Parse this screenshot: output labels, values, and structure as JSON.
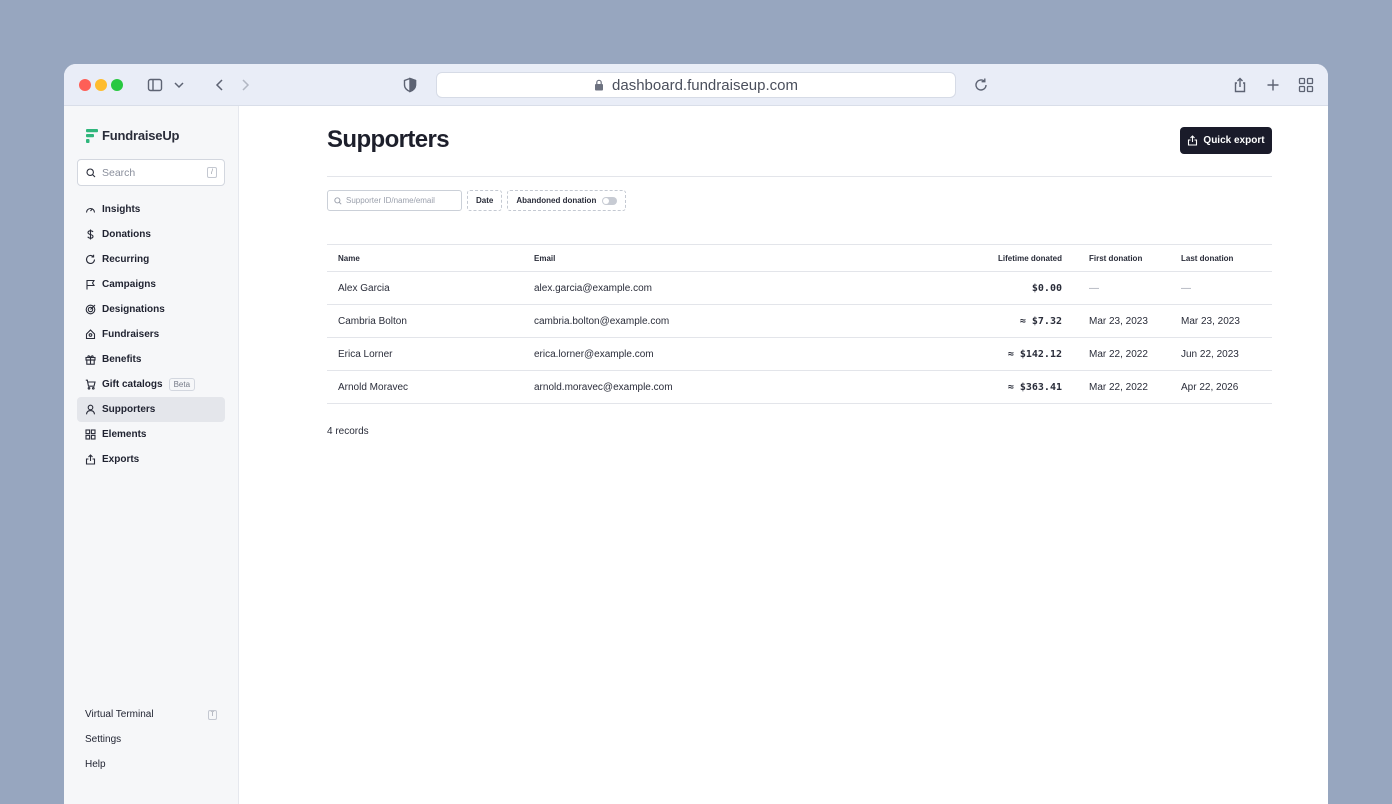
{
  "browser": {
    "url": "dashboard.fundraiseup.com"
  },
  "sidebar": {
    "brand": "FundraiseUp",
    "search_placeholder": "Search",
    "search_shortcut": "/",
    "items": [
      {
        "label": "Insights",
        "icon": "insights-icon"
      },
      {
        "label": "Donations",
        "icon": "dollar-icon"
      },
      {
        "label": "Recurring",
        "icon": "refresh-icon"
      },
      {
        "label": "Campaigns",
        "icon": "flag-icon"
      },
      {
        "label": "Designations",
        "icon": "target-icon"
      },
      {
        "label": "Fundraisers",
        "icon": "fundraiser-icon"
      },
      {
        "label": "Benefits",
        "icon": "gift-icon"
      },
      {
        "label": "Gift catalogs",
        "icon": "cart-icon",
        "badge": "Beta"
      },
      {
        "label": "Supporters",
        "icon": "person-icon",
        "active": true
      },
      {
        "label": "Elements",
        "icon": "grid-icon"
      },
      {
        "label": "Exports",
        "icon": "upload-icon"
      }
    ],
    "bottom": {
      "virtual_terminal": "Virtual Terminal",
      "virtual_terminal_shortcut": "T",
      "settings": "Settings",
      "help": "Help"
    }
  },
  "main": {
    "title": "Supporters",
    "export_label": "Quick export",
    "filters": {
      "search_placeholder": "Supporter ID/name/email",
      "date": "Date",
      "abandoned": "Abandoned donation"
    },
    "table": {
      "headers": {
        "name": "Name",
        "email": "Email",
        "lifetime": "Lifetime donated",
        "first": "First donation",
        "last": "Last donation"
      },
      "rows": [
        {
          "name": "Alex Garcia",
          "email": "alex.garcia@example.com",
          "lifetime": "$0.00",
          "first": "—",
          "last": "—"
        },
        {
          "name": "Cambria Bolton",
          "email": "cambria.bolton@example.com",
          "lifetime": "≈ $7.32",
          "first": "Mar 23, 2023",
          "last": "Mar 23, 2023"
        },
        {
          "name": "Erica Lorner",
          "email": "erica.lorner@example.com",
          "lifetime": "≈ $142.12",
          "first": "Mar 22, 2022",
          "last": "Jun 22, 2023"
        },
        {
          "name": "Arnold Moravec",
          "email": "arnold.moravec@example.com",
          "lifetime": "≈ $363.41",
          "first": "Mar 22, 2022",
          "last": "Apr 22, 2026"
        }
      ]
    },
    "records": "4 records"
  },
  "colors": {
    "brand_green": "#2fb67c",
    "primary_button": "#1a1b2a",
    "background": "#97a6bf"
  }
}
